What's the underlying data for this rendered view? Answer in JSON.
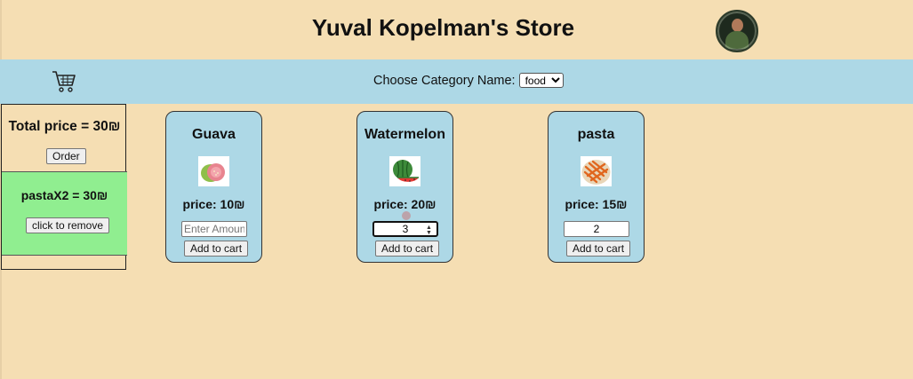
{
  "store": {
    "title": "Yuval Kopelman's Store"
  },
  "nav": {
    "cart_icon": "shopping-cart-icon",
    "category_label": "Choose Category Name:",
    "category_selected": "food"
  },
  "cart": {
    "total_text": "Total price = 30₪",
    "order_label": "Order",
    "items": [
      {
        "label": "pastaX2 = 30₪",
        "remove_label": "click to remove"
      }
    ]
  },
  "products": [
    {
      "name": "Guava",
      "price": "price: 10₪",
      "amount_value": "",
      "amount_placeholder": "Enter Amount",
      "add_label": "Add to cart",
      "image_icon": "guava-icon"
    },
    {
      "name": "Watermelon",
      "price": "price: 20₪",
      "amount_value": "3",
      "amount_placeholder": "",
      "add_label": "Add to cart",
      "image_icon": "watermelon-icon"
    },
    {
      "name": "pasta",
      "price": "price: 15₪",
      "amount_value": "2",
      "amount_placeholder": "",
      "add_label": "Add to cart",
      "image_icon": "pasta-icon"
    }
  ],
  "colors": {
    "background": "#f5deb3",
    "nav": "#add8e6",
    "card": "#add8e6",
    "cart_item": "#90ee90"
  }
}
